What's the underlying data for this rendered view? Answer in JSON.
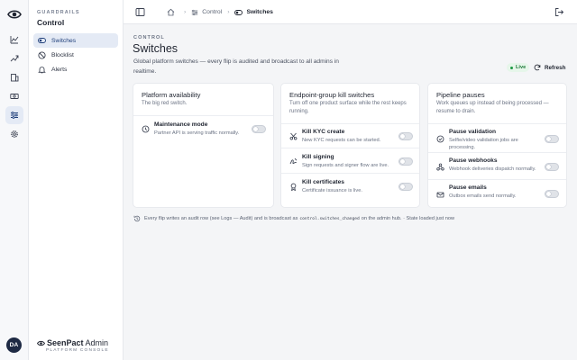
{
  "sidebar": {
    "kicker": "GUARDRAILS",
    "title": "Control",
    "items": [
      {
        "label": "Switches",
        "icon": "toggle-icon",
        "active": true
      },
      {
        "label": "Blocklist",
        "icon": "block-icon",
        "active": false
      },
      {
        "label": "Alerts",
        "icon": "bell-icon",
        "active": false
      }
    ],
    "brand": {
      "name_bold": "SeenPact",
      "name_rest": " Admin",
      "subtitle": "PLATFORM CONSOLE"
    }
  },
  "rail": {
    "items": [
      "chart-icon",
      "trend-icon",
      "building-icon",
      "cash-icon",
      "sliders-icon",
      "gear-icon"
    ],
    "active_index": 4,
    "avatar_initials": "DA"
  },
  "topbar": {
    "breadcrumbs": [
      {
        "label": "",
        "icon": "home-icon"
      },
      {
        "label": "Control",
        "icon": "sliders-icon"
      },
      {
        "label": "Switches",
        "icon": "toggle-icon"
      }
    ]
  },
  "header": {
    "kicker": "CONTROL",
    "title": "Switches",
    "description": "Global platform switches — every flip is audited and broadcast to all admins in realtime.",
    "live_label": "Live",
    "refresh_label": "Refresh"
  },
  "cards": [
    {
      "title": "Platform availability",
      "subtitle": "The big red switch.",
      "rows": [
        {
          "label": "Maintenance mode",
          "desc": "Partner API is serving traffic normally.",
          "icon": "clock-icon",
          "on": false
        }
      ]
    },
    {
      "title": "Endpoint-group kill switches",
      "subtitle": "Turn off one product surface while the rest keeps running.",
      "rows": [
        {
          "label": "Kill KYC create",
          "desc": "New KYC requests can be started.",
          "icon": "scissors-icon",
          "on": false
        },
        {
          "label": "Kill signing",
          "desc": "Sign requests and signer flow are live.",
          "icon": "signature-icon",
          "on": false
        },
        {
          "label": "Kill certificates",
          "desc": "Certificate issuance is live.",
          "icon": "certificate-icon",
          "on": false
        }
      ]
    },
    {
      "title": "Pipeline pauses",
      "subtitle": "Work queues up instead of being processed — resume to drain.",
      "rows": [
        {
          "label": "Pause validation",
          "desc": "Selfie/video validation jobs are processing.",
          "icon": "shield-icon",
          "on": false
        },
        {
          "label": "Pause webhooks",
          "desc": "Webhook deliveries dispatch normally.",
          "icon": "webhook-icon",
          "on": false
        },
        {
          "label": "Pause emails",
          "desc": "Outbox emails send normally.",
          "icon": "mail-icon",
          "on": false
        }
      ]
    }
  ],
  "footer": {
    "before": "Every flip writes an audit row (see Logs — Audit) and is broadcast as",
    "code": "control.switches_changed",
    "after": "on the admin hub. · State loaded just now"
  }
}
